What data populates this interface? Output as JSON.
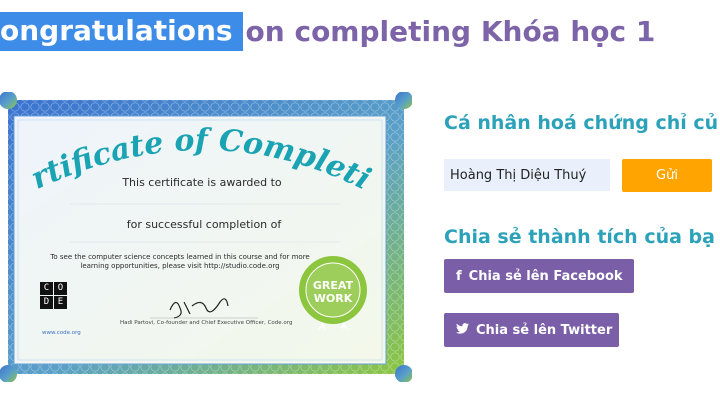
{
  "header": {
    "title_highlight": "ongratulations",
    "title_rest": "on completing Khóa học 1"
  },
  "certificate": {
    "heading": "Certificate of Completion",
    "awarded_line": "This certificate is awarded to",
    "completion_line": "for successful completion of",
    "info_text": "To see the computer science concepts learned in this course and for more learning opportunities, please visit http://studio.code.org",
    "signature_caption": "Hadi Partovi, Co-founder and Chief Executive Officer, Code.org",
    "site_label": "www.code.org",
    "logo_letters": [
      "C",
      "O",
      "D",
      "E"
    ],
    "badge": {
      "line1": "GREAT",
      "line2": "WORK"
    },
    "colors": {
      "border_blue": "#3f7fd6",
      "border_green": "#7cbf3a",
      "heading": "#1aa3b2",
      "badge": "#8cc63f"
    }
  },
  "personalize": {
    "heading": "Cá nhân hoá chứng chỉ củ",
    "name_value": "Hoàng Thị Diệu Thuý",
    "send_label": "Gửi"
  },
  "share": {
    "heading": "Chia sẻ thành tích của bạ",
    "facebook_label": "Chia sẻ lên Facebook",
    "facebook_icon": "facebook-icon",
    "twitter_label": "Chia sẻ lên Twitter",
    "twitter_icon": "twitter-icon"
  },
  "theme": {
    "title_highlight_bg": "#3d8ce8",
    "title_color": "#7d64a8",
    "accent": "#2ba2b9",
    "send_button": "#ffa400",
    "share_button": "#7a5ea8"
  }
}
